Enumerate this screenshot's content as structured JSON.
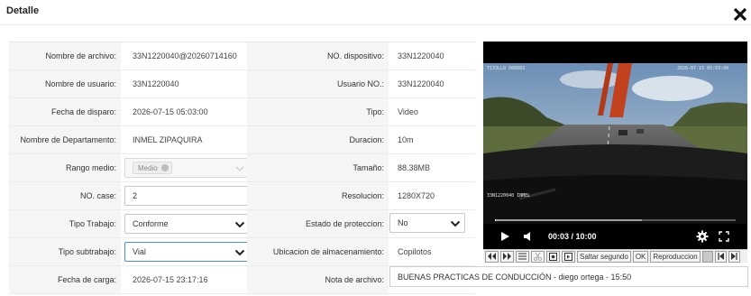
{
  "dialog": {
    "title": "Detalle",
    "close_icon": "close-icon"
  },
  "fields": {
    "file_name": {
      "label": "Nombre de archivo:",
      "value": "33N1220040@20260714160"
    },
    "device_no": {
      "label": "NO. dispositivo:",
      "value": "33N1220040"
    },
    "user_name": {
      "label": "Nombre de usuario:",
      "value": "33N1220040"
    },
    "user_no": {
      "label": "Usuario NO.:",
      "value": "33N1220040"
    },
    "trigger_date": {
      "label": "Fecha de disparo:",
      "value": "2026-07-15 05:03:00"
    },
    "type": {
      "label": "Tipo:",
      "value": "Video"
    },
    "department": {
      "label": "Nombre de Departamento:",
      "value": "INMEL ZIPAQUIRA"
    },
    "duration": {
      "label": "Duracion:",
      "value": "10m"
    },
    "range": {
      "label": "Rango medio:",
      "tag": "Medio"
    },
    "size": {
      "label": "Tamaño:",
      "value": "88.38MB"
    },
    "case_no": {
      "label": "NO. case:",
      "value": "2"
    },
    "resolution": {
      "label": "Resolucion:",
      "value": "1280X720"
    },
    "work_type": {
      "label": "Tipo Trabajo:",
      "value": "Conforme"
    },
    "protection": {
      "label": "Estado de proteccion:",
      "value": "No"
    },
    "subwork_type": {
      "label": "Tipo subtrabajo:",
      "value": "Vial"
    },
    "storage": {
      "label": "Ubicacion de almacenamiento:",
      "value": "Copilotos"
    },
    "upload_date": {
      "label": "Fecha de carga:",
      "value": "2026-07-15 23:17:16"
    },
    "file_note": {
      "label": "Nota de archivo:",
      "value": "BUENAS PRACTICAS DE CONDUCCIÓN - diego ortega - 15:50"
    }
  },
  "player": {
    "time": "00:03 / 10:00",
    "progress_fraction": 0.005,
    "buffered_fraction": 0.61,
    "overlay_left": "T133LL8 008083",
    "overlay_right": "2026-07-15 05:03:00",
    "overlay_bottom": "33N1220040 INMEL"
  },
  "toolbar": {
    "skip_label": "Saltar segundo",
    "ok_label": "OK",
    "playback_label": "Reproduccion"
  },
  "colors": {
    "label_bg": "#f5f5f5",
    "focus_border": "#4a90d9"
  }
}
